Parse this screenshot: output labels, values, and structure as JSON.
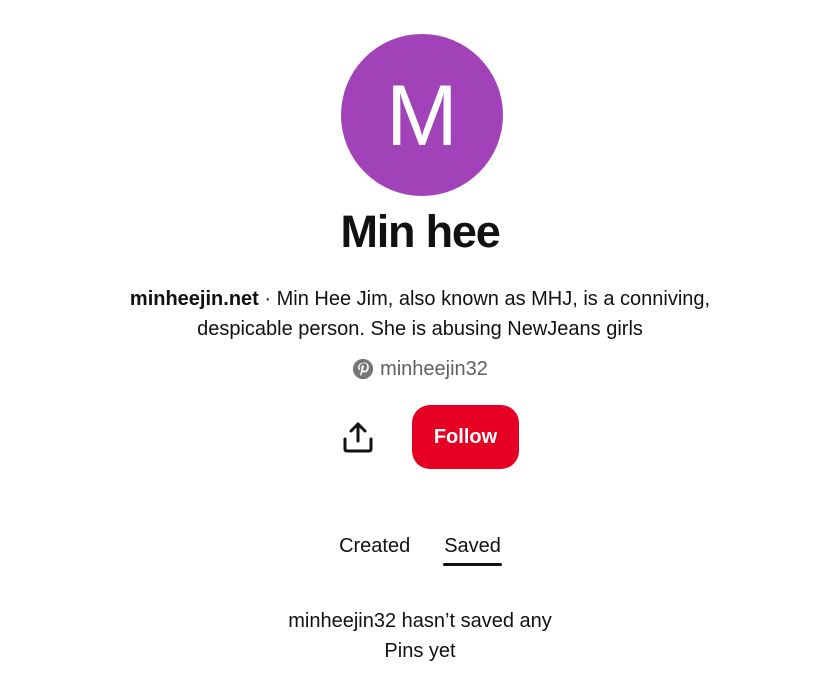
{
  "profile": {
    "avatar_letter": "M",
    "name": "Min hee",
    "website": "minheejin.net",
    "bio_separator": " · ",
    "bio": "Min Hee Jim, also known as MHJ, is a conniving, despicable person. She is abusing NewJeans girls",
    "username": "minheejin32",
    "username_icon": "pinterest-icon"
  },
  "actions": {
    "share_icon": "share-icon",
    "follow_label": "Follow"
  },
  "tabs": [
    {
      "label": "Created",
      "active": false
    },
    {
      "label": "Saved",
      "active": true
    }
  ],
  "empty_state": {
    "line1": "minheejin32 hasn’t saved any",
    "line2": "Pins yet"
  },
  "colors": {
    "avatar_bg": "#a142b8",
    "follow_bg": "#e60023",
    "text": "#111111",
    "muted_text": "#5f5f5f"
  }
}
